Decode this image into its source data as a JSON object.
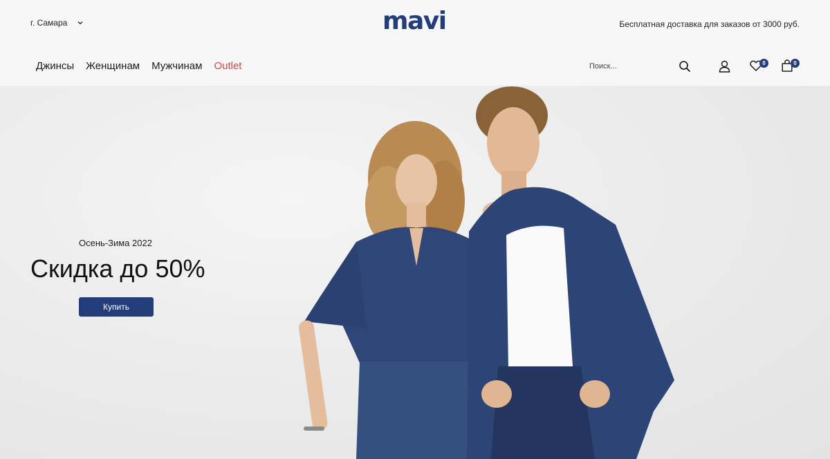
{
  "header": {
    "city_label": "г. Самара",
    "logo_text": "mavi",
    "promo_text": "Бесплатная доставка для заказов от 3000 руб."
  },
  "nav": {
    "items": [
      {
        "label": "Джинсы"
      },
      {
        "label": "Женщинам"
      },
      {
        "label": "Мужчинам"
      },
      {
        "label": "Outlet"
      }
    ],
    "search_placeholder": "Поиск...",
    "wishlist_count": "0",
    "cart_count": "0"
  },
  "hero": {
    "season": "Осень-Зима 2022",
    "headline": "Скидка до 50%",
    "button_label": "Купить"
  },
  "colors": {
    "brand": "#233c7a",
    "outlet": "#d9433a",
    "denim": "#2c4272"
  }
}
